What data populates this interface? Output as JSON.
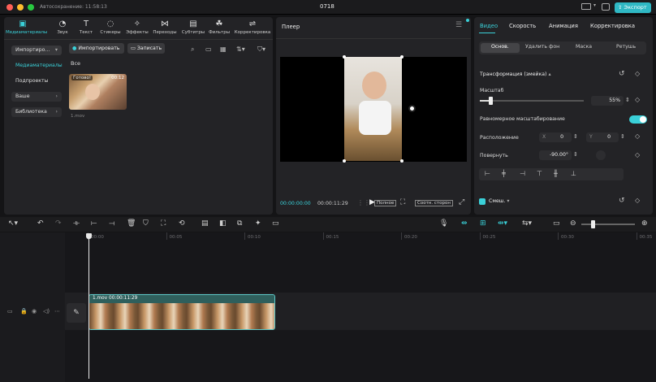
{
  "titlebar": {
    "autosave": "Автосохранение: 11:58:13",
    "project": "0718",
    "export": "Экспорт"
  },
  "toolbar": {
    "items": [
      {
        "label": "Медиаматериалы",
        "icon": "media-icon"
      },
      {
        "label": "Звук",
        "icon": "audio-icon"
      },
      {
        "label": "Текст",
        "icon": "text-icon"
      },
      {
        "label": "Стикеры",
        "icon": "sticker-icon"
      },
      {
        "label": "Эффекты",
        "icon": "effects-icon"
      },
      {
        "label": "Переходы",
        "icon": "transitions-icon"
      },
      {
        "label": "Субтитры",
        "icon": "subtitles-icon"
      },
      {
        "label": "Фильтры",
        "icon": "filters-icon"
      },
      {
        "label": "Корректировка",
        "icon": "adjust-icon"
      }
    ]
  },
  "media": {
    "sidebar": [
      "Импортиро...",
      "Медиаматериалы",
      "Подпроекты",
      "Ваше",
      "Библиотека"
    ],
    "import_label": "Импортировать",
    "record_label": "Записать",
    "filter_all": "Все",
    "clip": {
      "badge": "Готово!",
      "duration": "00:12",
      "name": "1.mov"
    }
  },
  "player": {
    "title": "Плеер",
    "current": "00:00:00:00",
    "total": "00:00:11:29",
    "full": "Полное",
    "ratio": "Соотн. сторон"
  },
  "inspector": {
    "tabs": [
      "Видео",
      "Скорость",
      "Анимация",
      "Корректировка"
    ],
    "subtabs": [
      "Основ.",
      "Удалить фон",
      "Маска",
      "Ретушь"
    ],
    "transform_label": "Трансформация (змейка)",
    "scale_label": "Масштаб",
    "scale_value": "55%",
    "scale_fraction": 0.1,
    "uniform_label": "Равномерное масштабирование",
    "position_label": "Расположение",
    "pos_x_label": "X",
    "pos_x": "0",
    "pos_y_label": "Y",
    "pos_y": "0",
    "rotate_label": "Повернуть",
    "rotate_value": "-90.00°",
    "blend_label": "Смеш."
  },
  "timeline": {
    "ruler": [
      "00:00",
      "00:05",
      "00:10",
      "00:15",
      "00:20",
      "00:25",
      "00:30",
      "00:35"
    ],
    "clip_name": "1.mov",
    "clip_duration": "00:00:11:29"
  }
}
